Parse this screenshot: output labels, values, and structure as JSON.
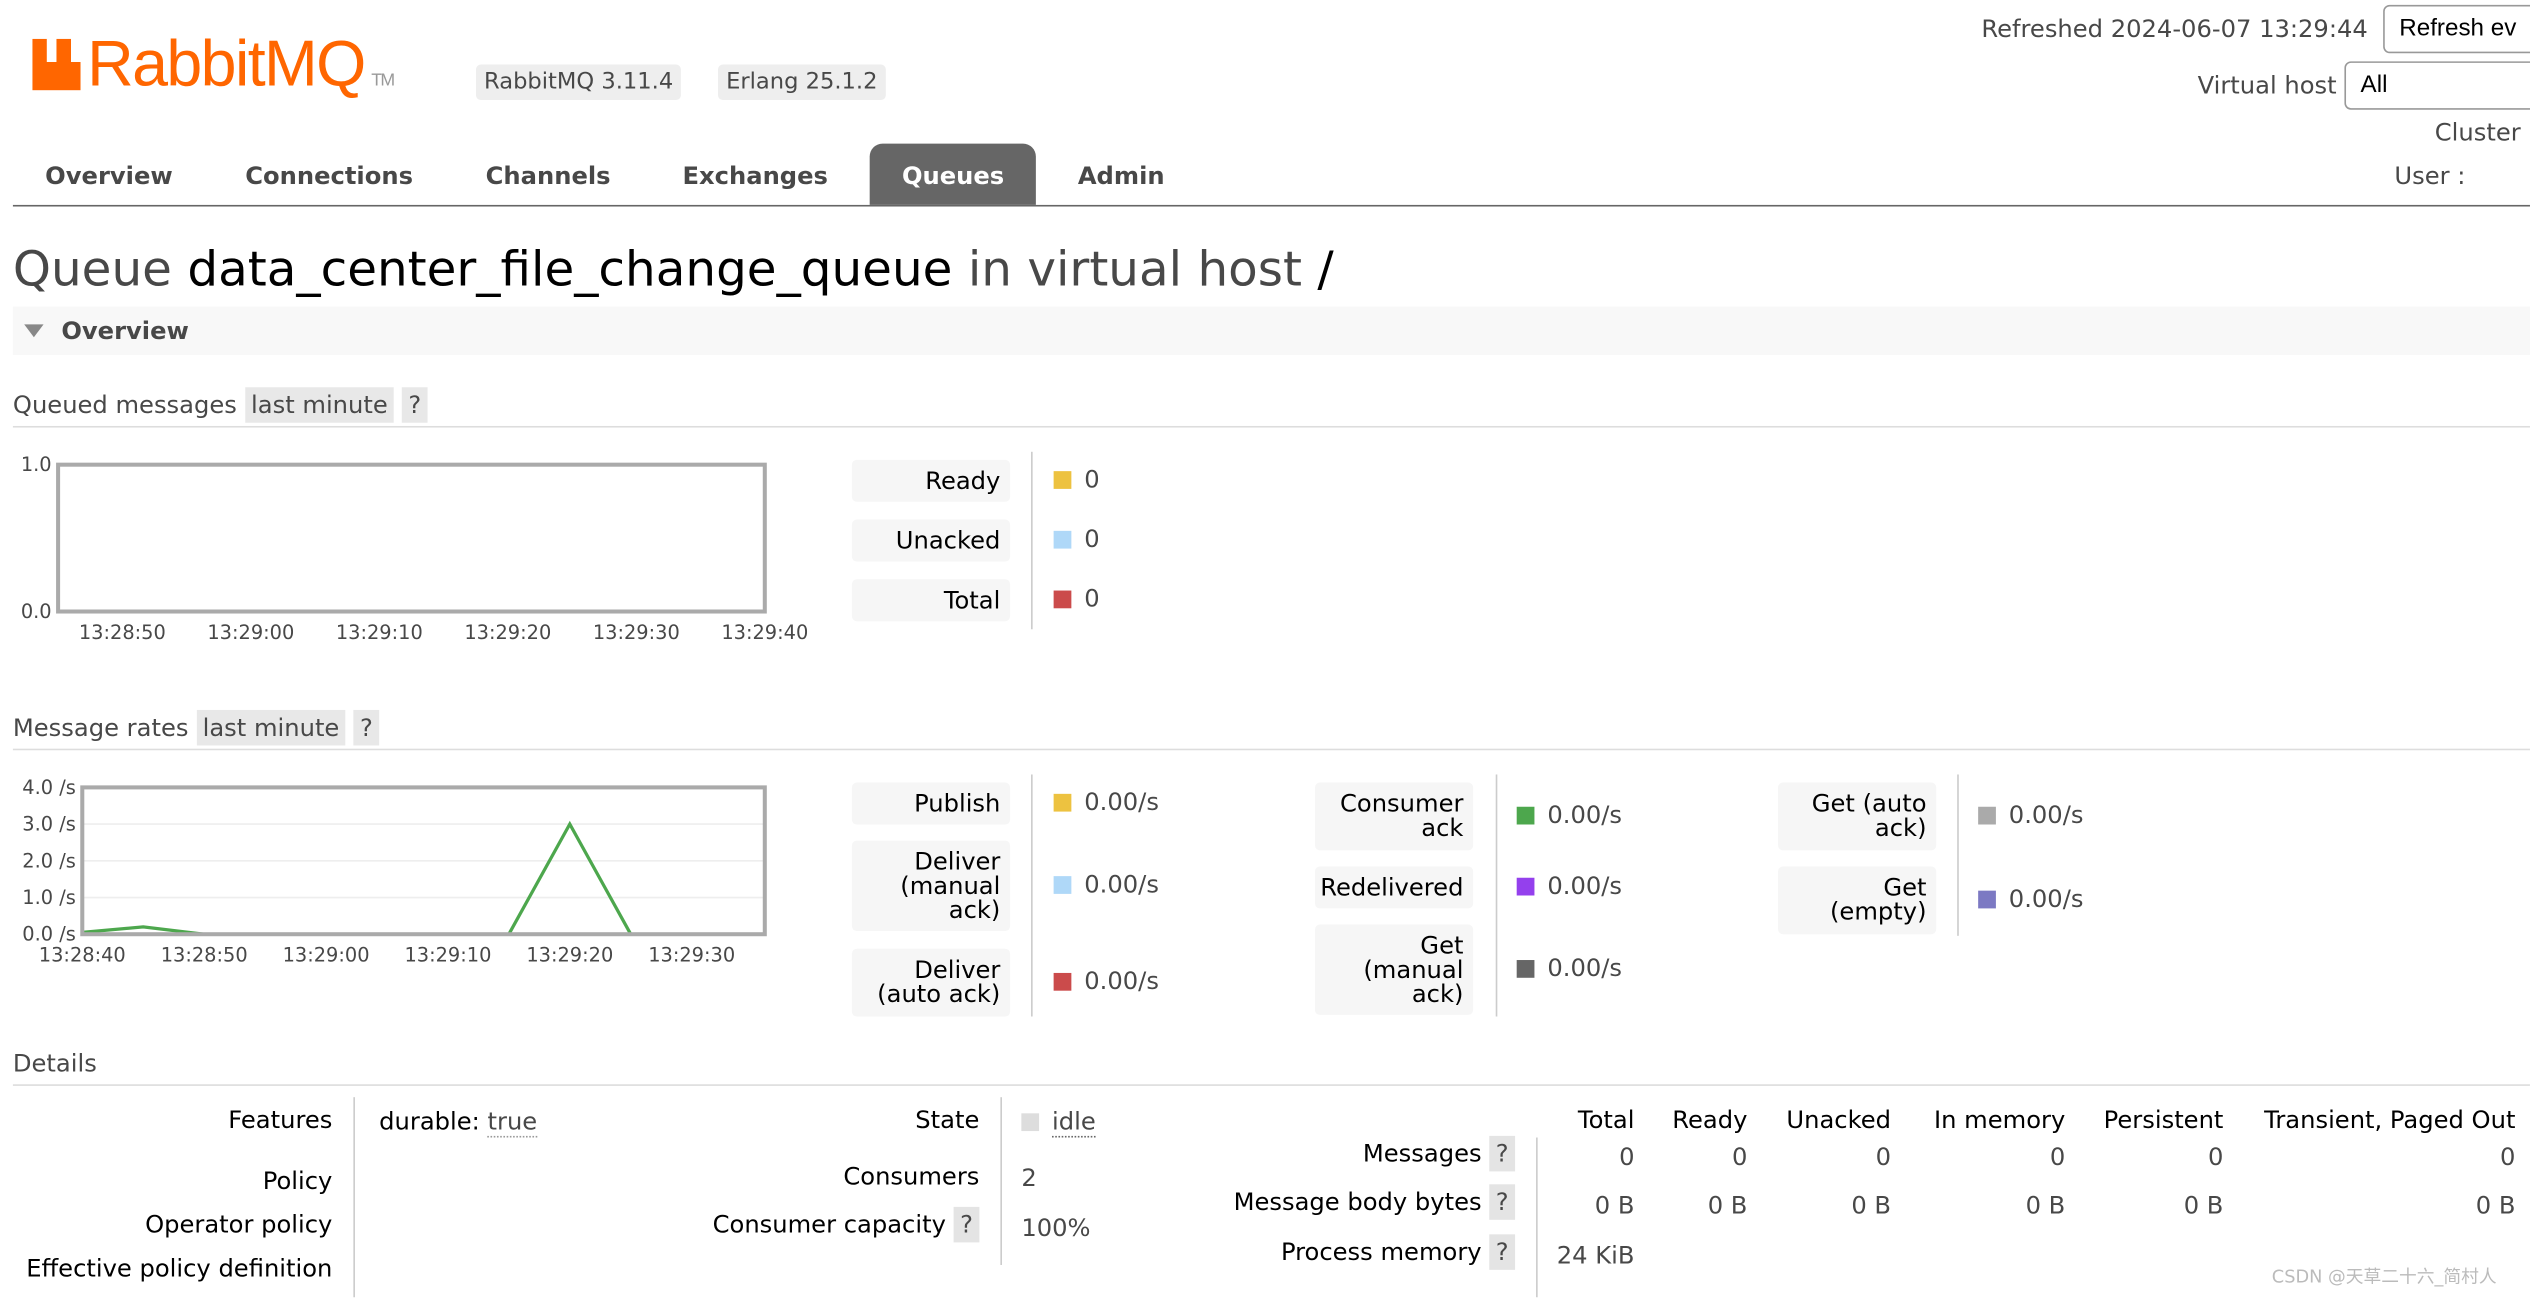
{
  "header": {
    "logo_text": "RabbitMQ",
    "logo_tm": "TM",
    "version": "RabbitMQ 3.11.4",
    "erlang": "Erlang 25.1.2",
    "refreshed": "Refreshed 2024-06-07 13:29:44",
    "refresh_select": "Refresh ev",
    "vhost_label": "Virtual host",
    "vhost_value": "All",
    "cluster_label": "Cluster",
    "user_label": "User :"
  },
  "nav": [
    {
      "label": "Overview"
    },
    {
      "label": "Connections"
    },
    {
      "label": "Channels"
    },
    {
      "label": "Exchanges"
    },
    {
      "label": "Queues",
      "selected": true
    },
    {
      "label": "Admin"
    }
  ],
  "title": {
    "prefix": "Queue",
    "name": "data_center_file_change_queue",
    "mid": "in virtual host",
    "vhost": "/"
  },
  "overview_section": "Overview",
  "queued": {
    "title": "Queued messages",
    "range": "last minute",
    "help": "?",
    "legend": [
      {
        "label": "Ready",
        "value": "0",
        "color": "#edc240"
      },
      {
        "label": "Unacked",
        "value": "0",
        "color": "#afd8f8"
      },
      {
        "label": "Total",
        "value": "0",
        "color": "#cb4b4b"
      }
    ]
  },
  "rates": {
    "title": "Message rates",
    "range": "last minute",
    "help": "?",
    "legend": [
      {
        "label": "Publish",
        "value": "0.00/s",
        "color": "#edc240"
      },
      {
        "label": "Deliver (manual ack)",
        "value": "0.00/s",
        "color": "#afd8f8"
      },
      {
        "label": "Deliver (auto ack)",
        "value": "0.00/s",
        "color": "#cb4b4b"
      },
      {
        "label": "Consumer ack",
        "value": "0.00/s",
        "color": "#4da74d"
      },
      {
        "label": "Redelivered",
        "value": "0.00/s",
        "color": "#9440ed"
      },
      {
        "label": "Get (manual ack)",
        "value": "0.00/s",
        "color": "#666666"
      },
      {
        "label": "Get (auto ack)",
        "value": "0.00/s",
        "color": "#aaaaaa"
      },
      {
        "label": "Get (empty)",
        "value": "0.00/s",
        "color": "#7c79c3"
      }
    ]
  },
  "chart_data": [
    {
      "type": "line",
      "title": "Queued messages",
      "ylim": [
        0,
        1
      ],
      "yticks": [
        "0.0",
        "1.0"
      ],
      "xticks": [
        "13:28:50",
        "13:29:00",
        "13:29:10",
        "13:29:20",
        "13:29:30",
        "13:29:40"
      ],
      "xlim": [
        "13:28:45",
        "13:29:40"
      ],
      "x": [
        "13:28:45",
        "13:29:40"
      ],
      "series": [
        {
          "name": "Ready",
          "values": [
            0,
            0
          ]
        },
        {
          "name": "Unacked",
          "values": [
            0,
            0
          ]
        },
        {
          "name": "Total",
          "values": [
            0,
            0
          ]
        }
      ]
    },
    {
      "type": "line",
      "title": "Message rates",
      "ylim": [
        0,
        4
      ],
      "yticks": [
        "0.0 /s",
        "1.0 /s",
        "2.0 /s",
        "3.0 /s",
        "4.0 /s"
      ],
      "xticks": [
        "13:28:40",
        "13:28:50",
        "13:29:00",
        "13:29:10",
        "13:29:20",
        "13:29:30"
      ],
      "xlim": [
        "13:28:40",
        "13:29:36"
      ],
      "x": [
        "13:28:40",
        "13:28:45",
        "13:28:50",
        "13:28:55",
        "13:29:00",
        "13:29:05",
        "13:29:10",
        "13:29:15",
        "13:29:20",
        "13:29:25",
        "13:29:30",
        "13:29:35"
      ],
      "series": [
        {
          "name": "Consumer ack",
          "values": [
            0.05,
            0.2,
            0,
            0,
            0,
            0,
            0,
            0,
            3.0,
            0,
            0,
            0
          ]
        },
        {
          "name": "Get (empty)",
          "values": [
            0,
            0,
            0,
            0,
            0,
            0,
            0,
            0,
            0,
            0,
            0,
            0
          ]
        }
      ]
    }
  ],
  "details": {
    "title": "Details",
    "features_label": "Features",
    "features_key": "durable:",
    "features_val": "true",
    "policy_label": "Policy",
    "operator_policy_label": "Operator policy",
    "effective_policy_label": "Effective policy definition",
    "state_label": "State",
    "state_val": "idle",
    "consumers_label": "Consumers",
    "consumers_val": "2",
    "capacity_label": "Consumer capacity",
    "capacity_val": "100%",
    "help": "?",
    "columns": [
      "Total",
      "Ready",
      "Unacked",
      "In memory",
      "Persistent",
      "Transient, Paged Out"
    ],
    "rows": [
      {
        "label": "Messages",
        "values": [
          "0",
          "0",
          "0",
          "0",
          "0",
          "0"
        ]
      },
      {
        "label": "Message body bytes",
        "values": [
          "0 B",
          "0 B",
          "0 B",
          "0 B",
          "0 B",
          "0 B"
        ]
      },
      {
        "label": "Process memory",
        "values": [
          "24 KiB"
        ]
      }
    ]
  },
  "watermark": "CSDN @天草二十六_简村人"
}
